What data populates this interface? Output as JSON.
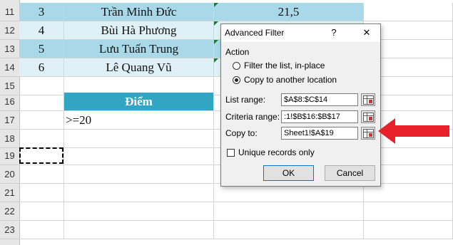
{
  "sheet": {
    "rows": [
      {
        "num": "11",
        "a": "3",
        "b": "Trần Minh Đức",
        "c": "21,5"
      },
      {
        "num": "12",
        "a": "4",
        "b": "Bùi Hà Phương",
        "c": ""
      },
      {
        "num": "13",
        "a": "5",
        "b": "Lưu Tuấn Trung",
        "c": ""
      },
      {
        "num": "14",
        "a": "6",
        "b": "Lê Quang Vũ",
        "c": ""
      },
      {
        "num": "15",
        "a": "",
        "b": "",
        "c": ""
      },
      {
        "num": "16",
        "a": "",
        "b": "Điểm",
        "c": ""
      },
      {
        "num": "17",
        "a": "",
        "b": ">=20",
        "c": ""
      },
      {
        "num": "18",
        "a": "",
        "b": "",
        "c": ""
      },
      {
        "num": "19",
        "a": "",
        "b": "",
        "c": ""
      },
      {
        "num": "20",
        "a": "",
        "b": "",
        "c": ""
      },
      {
        "num": "21",
        "a": "",
        "b": "",
        "c": ""
      },
      {
        "num": "22",
        "a": "",
        "b": "",
        "c": ""
      },
      {
        "num": "23",
        "a": "",
        "b": "",
        "c": ""
      }
    ],
    "colors": {
      "band_dark": "#a9d9e8",
      "band_light": "#dff1f7",
      "header": "#31a5c2"
    }
  },
  "dialog": {
    "title": "Advanced Filter",
    "help": "?",
    "close": "✕",
    "action_label": "Action",
    "radio_filter": "Filter the list, in-place",
    "radio_copy": "Copy to another location",
    "list_range_label": "List range:",
    "list_range_value": "$A$8:$C$14",
    "criteria_range_label": "Criteria range:",
    "criteria_range_value": ":1!$B$16:$B$17",
    "copy_to_label": "Copy to:",
    "copy_to_value": "Sheet1!$A$19",
    "unique_label": "Unique records only",
    "ok_label": "OK",
    "cancel_label": "Cancel"
  },
  "icons": {
    "ref_button": "range-selector-icon",
    "pointer": "red-arrow-icon"
  },
  "accent": {
    "arrow_color": "#e8202a"
  }
}
